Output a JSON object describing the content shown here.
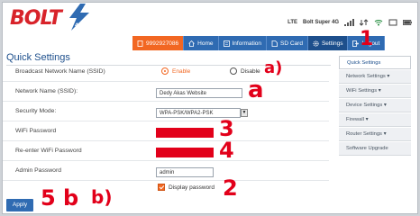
{
  "brand": {
    "logo_text": "BOLT",
    "logo_sub": "4G"
  },
  "status": {
    "network": "LTE",
    "operator": "Bolt Super 4G"
  },
  "nav": [
    {
      "label": "9992927086",
      "icon": "sim-card-icon"
    },
    {
      "label": "Home",
      "icon": "home-icon"
    },
    {
      "label": "Information",
      "icon": "info-icon"
    },
    {
      "label": "SD Card",
      "icon": "sd-card-icon"
    },
    {
      "label": "Settings",
      "icon": "gear-icon"
    },
    {
      "label": "Logout",
      "icon": "logout-icon"
    }
  ],
  "page": {
    "title": "Quick Settings"
  },
  "form": {
    "ssid_broadcast_label": "Broadcast Network Name (SSID)",
    "enable_label": "Enable",
    "disable_label": "Disable",
    "ssid_label": "Network Name (SSID):",
    "ssid_value": "Dedy Akas Website",
    "security_label": "Security Mode:",
    "security_value": "WPA-PSK/WPA2-PSK",
    "wifi_password_label": "WiFi Password",
    "reenter_password_label": "Re-enter WiFi Password",
    "admin_password_label": "Admin Password",
    "admin_password_value": "admin",
    "display_password_label": "Display password",
    "apply_label": "Apply"
  },
  "sidebar": [
    {
      "label": "Quick Settings"
    },
    {
      "label": "Network Settings ▾"
    },
    {
      "label": "WiFi Settings ▾"
    },
    {
      "label": "Device Settings ▾"
    },
    {
      "label": "Firewall ▾"
    },
    {
      "label": "Router Settings ▾"
    },
    {
      "label": "Software Upgrade"
    }
  ],
  "annotations": {
    "one": "1",
    "a_paren": "a)",
    "a": "a",
    "three": "3",
    "four": "4",
    "two": "2",
    "five_b": "5 b",
    "b_paren": "b)"
  },
  "colors": {
    "brand_red": "#d8232a",
    "accent_orange": "#f26722",
    "nav_blue": "#2f6bb2",
    "annotation_red": "#e2001a"
  }
}
